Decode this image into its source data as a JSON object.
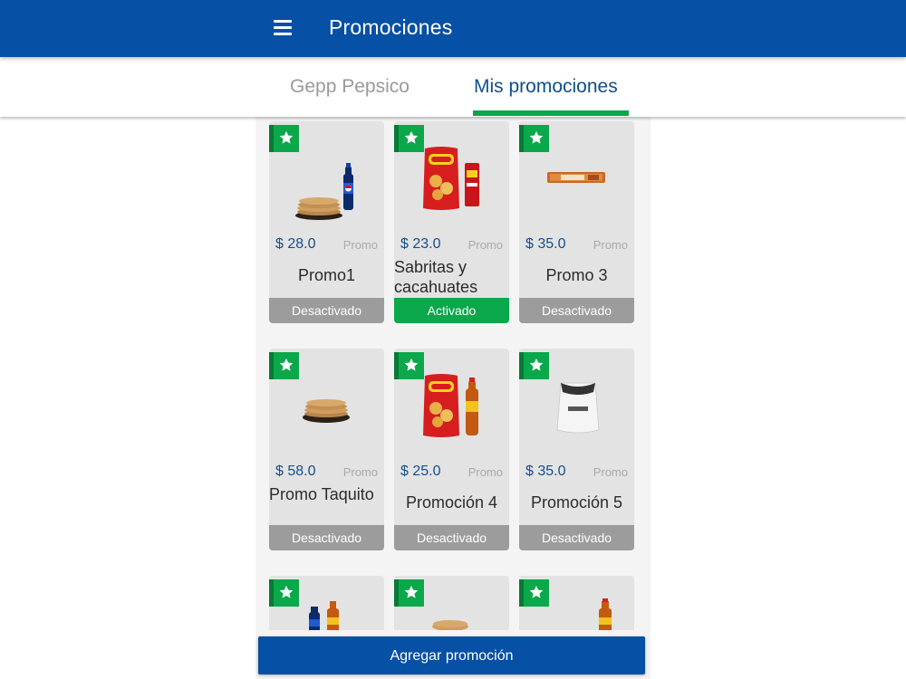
{
  "app_bar": {
    "title": "Promociones",
    "menu_icon": "hamburger-menu-icon"
  },
  "tabs": [
    {
      "label": "Gepp Pepsico",
      "selected": false
    },
    {
      "label": "Mis promociones",
      "selected": true
    }
  ],
  "colors": {
    "primary": "#0650a5",
    "accent_green": "#0aa84a",
    "inactive_gray": "#9c9c9c",
    "price_blue": "#124f8e"
  },
  "cards": [
    {
      "price": "$ 28.0",
      "tag": "Promo",
      "name": "Promo1",
      "status": "Desactivado",
      "image": "tortillas-and-pepsi-bottle"
    },
    {
      "price": "$ 23.0",
      "tag": "Promo",
      "name": "Sabritas y cacahuates",
      "status": "Activado",
      "image": "sabritas-bag-and-peanuts"
    },
    {
      "price": "$ 35.0",
      "tag": "Promo",
      "name": "Promo 3",
      "status": "Desactivado",
      "image": "emperador-cookie-bar"
    },
    {
      "price": "$ 58.0",
      "tag": "Promo",
      "name": "Promo Taquito",
      "status": "Desactivado",
      "image": "tortillas-stack"
    },
    {
      "price": "$ 25.0",
      "tag": "Promo",
      "name": "Promoción 4",
      "status": "Desactivado",
      "image": "sabritas-bag-and-soda"
    },
    {
      "price": "$ 35.0",
      "tag": "Promo",
      "name": "Promoción 5",
      "status": "Desactivado",
      "image": "flour-sack"
    },
    {
      "image": "pepsi-and-soda-bottles"
    },
    {
      "image": "tortillas-stack"
    },
    {
      "image": "soda-bottle"
    }
  ],
  "add_button": {
    "label": "Agregar promoción"
  }
}
